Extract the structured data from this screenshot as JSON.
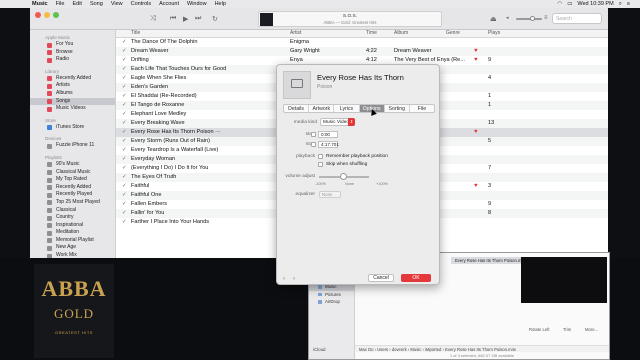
{
  "menubar": {
    "items": [
      "Music",
      "File",
      "Edit",
      "Song",
      "View",
      "Controls",
      "Account",
      "Window",
      "Help"
    ],
    "clock": "Wed 10:39 PM"
  },
  "now_playing": {
    "title": "S.O.S.",
    "subtitle": "ABBA — Gold: Greatest Hits"
  },
  "search_placeholder": "Search",
  "sidebar": {
    "sections": [
      {
        "heading": "Apple Music",
        "items": [
          {
            "label": "For You",
            "color": "#e4495b"
          },
          {
            "label": "Browse",
            "color": "#e4495b"
          },
          {
            "label": "Radio",
            "color": "#e4495b"
          }
        ]
      },
      {
        "heading": "Library",
        "items": [
          {
            "label": "Recently Added",
            "color": "#e4495b"
          },
          {
            "label": "Artists",
            "color": "#e4495b"
          },
          {
            "label": "Albums",
            "color": "#e4495b"
          },
          {
            "label": "Songs",
            "color": "#e4495b",
            "selected": true
          },
          {
            "label": "Music Videos",
            "color": "#e4495b"
          }
        ]
      },
      {
        "heading": "Store",
        "items": [
          {
            "label": "iTunes Store",
            "color": "#3b82d8"
          }
        ]
      },
      {
        "heading": "Devices",
        "items": [
          {
            "label": "Fuzzie iPhone 11",
            "color": "#8e8e93"
          }
        ]
      },
      {
        "heading": "Playlists",
        "items": [
          {
            "label": "90's Music",
            "color": "#8e8e93"
          },
          {
            "label": "Classical Music",
            "color": "#8e8e93"
          },
          {
            "label": "My Top Rated",
            "color": "#8e8e93"
          },
          {
            "label": "Recently Added",
            "color": "#8e8e93"
          },
          {
            "label": "Recently Played",
            "color": "#8e8e93"
          },
          {
            "label": "Top 25 Most Played",
            "color": "#8e8e93"
          },
          {
            "label": "Classical",
            "color": "#8e8e93"
          },
          {
            "label": "Country",
            "color": "#8e8e93"
          },
          {
            "label": "Inspirational",
            "color": "#8e8e93"
          },
          {
            "label": "Meditation",
            "color": "#8e8e93"
          },
          {
            "label": "Memorial Playlist",
            "color": "#8e8e93"
          },
          {
            "label": "New Age",
            "color": "#8e8e93"
          },
          {
            "label": "Work Mix",
            "color": "#8e8e93"
          }
        ]
      }
    ]
  },
  "columns": {
    "title": "Title",
    "artist": "Artist",
    "time": "Time",
    "album": "Album",
    "genre": "Genre",
    "plays": "Plays"
  },
  "songs": [
    {
      "title": "The Dance Of The Dolphin",
      "artist": "Enigma",
      "time": "",
      "album": "",
      "genre": "",
      "heart": "",
      "plays": ""
    },
    {
      "title": "Dream Weaver",
      "artist": "Gary Wright",
      "time": "4:22",
      "album": "Dream Weaver",
      "genre": "Pop",
      "heart": "♥",
      "plays": ""
    },
    {
      "title": "Drifting",
      "artist": "Enya",
      "time": "4:12",
      "album": "The Very Best of Enya (Re...",
      "genre": "Pop",
      "heart": "♥",
      "plays": "9"
    },
    {
      "title": "Each Life That Touches Ours for Good",
      "artist": "Afterg",
      "time": "",
      "album": "",
      "genre": "",
      "heart": "",
      "plays": ""
    },
    {
      "title": "Eagle When She Flies",
      "artist": "Dolly P",
      "time": "",
      "album": "",
      "genre": "",
      "heart": "",
      "plays": "4"
    },
    {
      "title": "Eden's Garden",
      "artist": "Kenne",
      "time": "",
      "album": "",
      "genre": "",
      "heart": "",
      "plays": ""
    },
    {
      "title": "El Shaddai (Re-Recorded)",
      "artist": "Amy G",
      "time": "",
      "album": "",
      "genre": "",
      "heart": "",
      "plays": "1"
    },
    {
      "title": "El Tango de Roxanne",
      "artist": "Ewan",
      "time": "",
      "album": "",
      "genre": "",
      "heart": "",
      "plays": "1"
    },
    {
      "title": "Elephant Love Medley",
      "artist": "Nicole",
      "time": "",
      "album": "",
      "genre": "",
      "heart": "",
      "plays": ""
    },
    {
      "title": "Every Breaking Wave",
      "artist": "U2",
      "time": "",
      "album": "",
      "genre": "",
      "heart": "",
      "plays": "13"
    },
    {
      "title": "Every Rose Has Its Thorn Poison ···",
      "artist": "",
      "time": "",
      "album": "",
      "genre": "",
      "heart": "♥",
      "plays": ""
    },
    {
      "title": "Every Storm (Runs Out of Rain)",
      "artist": "Gary A",
      "time": "",
      "album": "",
      "genre": "",
      "heart": "",
      "plays": "5"
    },
    {
      "title": "Every Teardrop Is a Waterfall (Live)",
      "artist": "Coldpl",
      "time": "",
      "album": "",
      "genre": "",
      "heart": "",
      "plays": ""
    },
    {
      "title": "Everyday Woman",
      "artist": "Emme",
      "time": "",
      "album": "",
      "genre": "",
      "heart": "",
      "plays": ""
    },
    {
      "title": "(Everything I Do) I Do It for You",
      "artist": "Bryan",
      "time": "",
      "album": "",
      "genre": "",
      "heart": "",
      "plays": "7"
    },
    {
      "title": "The Eyes Of Truth",
      "artist": "Enigm",
      "time": "",
      "album": "",
      "genre": "",
      "heart": "",
      "plays": ""
    },
    {
      "title": "Faithful",
      "artist": "Elicab",
      "time": "",
      "album": "",
      "genre": "",
      "heart": "♥",
      "plays": "3"
    },
    {
      "title": "Faithful One",
      "artist": "Selah",
      "time": "",
      "album": "",
      "genre": "",
      "heart": "",
      "plays": ""
    },
    {
      "title": "Fallen Embers",
      "artist": "Enya",
      "time": "",
      "album": "",
      "genre": "",
      "heart": "",
      "plays": "9"
    },
    {
      "title": "Fallin' for You",
      "artist": "Colbie",
      "time": "",
      "album": "",
      "genre": "",
      "heart": "",
      "plays": "8"
    },
    {
      "title": "Farther I Place Into Your Hands",
      "artist": "Ingrid",
      "time": "",
      "album": "",
      "genre": "",
      "heart": "",
      "plays": ""
    }
  ],
  "album_cover": {
    "band": "ABBA",
    "title": "GOLD",
    "subtitle": "GREATEST HITS"
  },
  "finder": {
    "sidebar": [
      "Libraries",
      "Pictures",
      "Websites",
      "Movies",
      "Music",
      "Pictures",
      "AirDrop"
    ],
    "selected": "Music",
    "icloud": "iCloud",
    "file": "Every Rose Has Its Thorn Poison.m4v",
    "path": "Mac Do ›  Users ›  dovenrk ›  Music ›  iMported ›  Every Rose Has Its Thorn Poison.m4v",
    "status": "1 of 4 selected, 682.07 GB available",
    "actions": [
      "Rotate Left",
      "Trim",
      "More..."
    ]
  },
  "dialog": {
    "title": "Every Rose Has Its Thorn",
    "subtitle": "Poison",
    "tabs": [
      "Details",
      "Artwork",
      "Lyrics",
      "Options",
      "Sorting",
      "File"
    ],
    "active_tab": "Options",
    "media_kind_label": "media kind",
    "media_kind": "Music Video",
    "start_label": "start",
    "start_value": "0:00",
    "stop_label": "stop",
    "stop_value": "4:17.701",
    "playback_label": "playback",
    "remember_position": "Remember playback position",
    "skip_shuffling": "Skip when shuffling",
    "volume_label": "volume adjust",
    "volume_min": "-100%",
    "volume_mid": "None",
    "volume_max": "+100%",
    "equalizer_label": "equalizer",
    "equalizer_value": "None",
    "cancel": "Cancel",
    "ok": "OK",
    "ok_color": "#e5383b"
  }
}
